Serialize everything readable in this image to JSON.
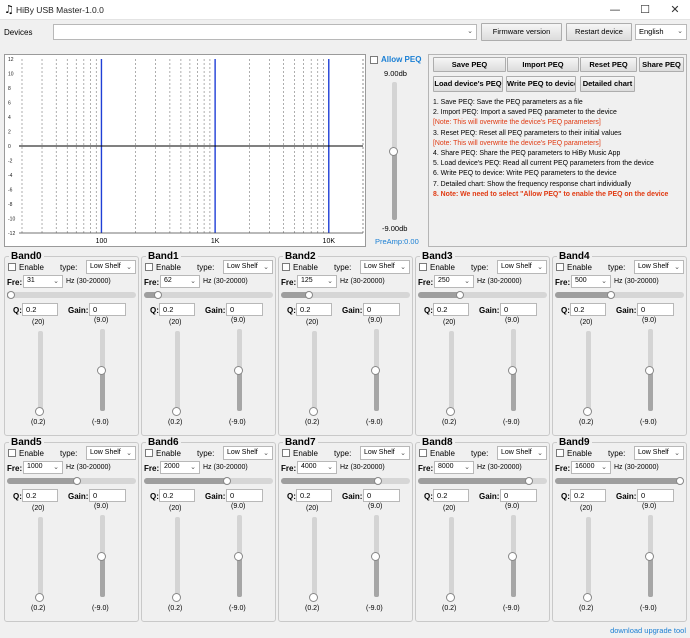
{
  "window": {
    "title": "HiBy USB Master-1.0.0",
    "minimize": "—",
    "maximize": "☐",
    "close": "✕"
  },
  "devices": {
    "label": "Devices",
    "value": "",
    "firmware_button": "Firmware version",
    "restart_button": "Restart device",
    "language": "English"
  },
  "chart": {
    "y_ticks": [
      "12",
      "10",
      "8",
      "6",
      "4",
      "2",
      "0",
      "-2",
      "-4",
      "-6",
      "-8",
      "-10",
      "-12"
    ],
    "x_ticks": [
      "100",
      "1K",
      "10K"
    ],
    "x_scale": "log",
    "xlim": [
      20,
      20000
    ],
    "ylim": [
      -12,
      12
    ],
    "grid": true,
    "band_freqs_hz": [
      31,
      62,
      125,
      250,
      500,
      1000,
      2000,
      4000,
      8000,
      16000
    ],
    "marker_freqs_hz": [
      100,
      1000,
      10000
    ],
    "curve_gain_db": 0,
    "grid_color": "#7a7a7a",
    "marker_color": "#1f3fd6",
    "curve_color": "#000000"
  },
  "preamp": {
    "allow_peq_label": "Allow PEQ",
    "allow_peq_checked": false,
    "max_label": "9.00db",
    "min_label": "-9.00db",
    "value_label": "PreAmp:0.00",
    "value_db": 0,
    "range_db": [
      -9,
      9
    ]
  },
  "peq_buttons": {
    "save": "Save PEQ",
    "import": "Import PEQ",
    "reset": "Reset PEQ",
    "share": "Share PEQ",
    "load": "Load device's PEQ",
    "write": "Write PEQ to device",
    "detailed": "Detailed  chart"
  },
  "notes": [
    {
      "text": "1. Save PEQ: Save the PEQ parameters as a file",
      "style": "normal"
    },
    {
      "text": "2. Import PEQ: Import a saved PEQ parameter to the device",
      "style": "normal"
    },
    {
      "text": "[Note: This will overwrite the device's PEQ parameters]",
      "style": "red"
    },
    {
      "text": "3. Reset PEQ: Reset all PEQ parameters to their initial values",
      "style": "normal"
    },
    {
      "text": "[Note: This will overwrite the device's PEQ parameters]",
      "style": "red"
    },
    {
      "text": "4. Share PEQ: Share the PEQ parameters to HiBy Music App",
      "style": "normal"
    },
    {
      "text": "5. Load device's PEQ: Read all current PEQ parameters from the device",
      "style": "normal"
    },
    {
      "text": "6. Write PEQ to device: Write PEQ parameters to the device",
      "style": "normal"
    },
    {
      "text": "7. Detailed chart: Show the frequency response chart individually",
      "style": "normal"
    },
    {
      "text": "8. Note: We need to select \"Allow PEQ\" to enable the PEQ on the device",
      "style": "redb"
    }
  ],
  "band_labels": {
    "enable": "Enable",
    "type": "type:",
    "fre": "Fre:",
    "range": "Hz (30-20000)",
    "q": "Q:",
    "gain": "Gain:",
    "q_max": "(20)",
    "q_min": "(0.2)",
    "gain_max": "(9.0)",
    "gain_min": "(-9.0)"
  },
  "bands": [
    {
      "name": "Band0",
      "type": "Low Shelf",
      "freq": "31",
      "q": "0.2",
      "gain": "0",
      "enabled": false
    },
    {
      "name": "Band1",
      "type": "Low Shelf",
      "freq": "62",
      "q": "0.2",
      "gain": "0",
      "enabled": false
    },
    {
      "name": "Band2",
      "type": "Low Shelf",
      "freq": "125",
      "q": "0.2",
      "gain": "0",
      "enabled": false
    },
    {
      "name": "Band3",
      "type": "Low Shelf",
      "freq": "250",
      "q": "0.2",
      "gain": "0",
      "enabled": false
    },
    {
      "name": "Band4",
      "type": "Low Shelf",
      "freq": "500",
      "q": "0.2",
      "gain": "0",
      "enabled": false
    },
    {
      "name": "Band5",
      "type": "Low Shelf",
      "freq": "1000",
      "q": "0.2",
      "gain": "0",
      "enabled": false
    },
    {
      "name": "Band6",
      "type": "Low Shelf",
      "freq": "2000",
      "q": "0.2",
      "gain": "0",
      "enabled": false
    },
    {
      "name": "Band7",
      "type": "Low Shelf",
      "freq": "4000",
      "q": "0.2",
      "gain": "0",
      "enabled": false
    },
    {
      "name": "Band8",
      "type": "Low Shelf",
      "freq": "8000",
      "q": "0.2",
      "gain": "0",
      "enabled": false
    },
    {
      "name": "Band9",
      "type": "Low Shelf",
      "freq": "16000",
      "q": "0.2",
      "gain": "0",
      "enabled": false
    }
  ],
  "status": {
    "download_link": "download upgrade tool"
  }
}
